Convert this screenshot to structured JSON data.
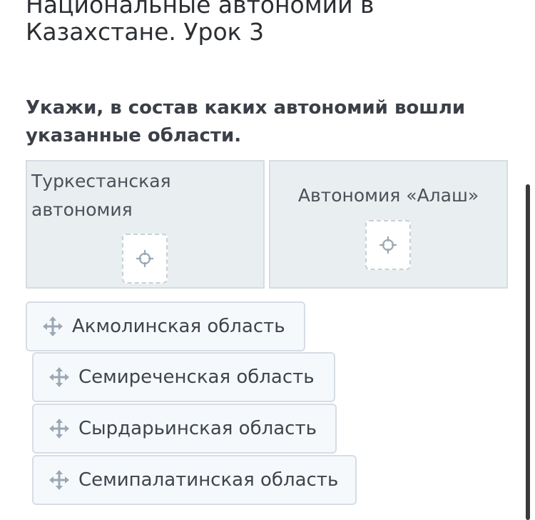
{
  "lesson": {
    "title": "Национальные автономии в Казахстане. Урок 3"
  },
  "task": {
    "instruction": "Укажи, в состав каких автономий вошли указанные области."
  },
  "drop_zones": [
    {
      "label": "Туркестанская автономия"
    },
    {
      "label": "Автономия «Алаш»"
    }
  ],
  "tiles": [
    {
      "label": "Акмолинская область"
    },
    {
      "label": "Семиреченская область"
    },
    {
      "label": "Сырдарьинская область"
    },
    {
      "label": "Семипалатинская область"
    }
  ],
  "icons": {
    "drag_handle": "move-arrows-icon",
    "drop_target": "crosshair-icon"
  },
  "colors": {
    "zone_background": "#e9eef1",
    "tile_background": "#f6f9fc",
    "icon": "#9aa8b4"
  }
}
